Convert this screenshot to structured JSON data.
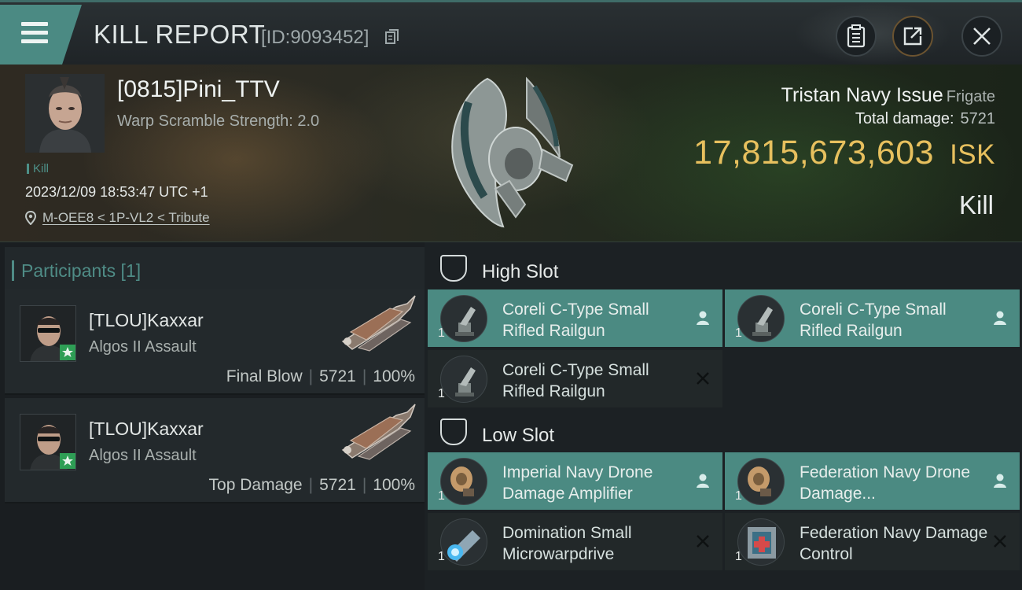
{
  "window": {
    "title": "KILL REPORT",
    "report_id": "[ID:9093452]"
  },
  "victim": {
    "name": "[0815]Pini_TTV",
    "warp_scramble": "Warp Scramble Strength: 2.0",
    "kill_tag": "Kill",
    "datetime": "2023/12/09 18:53:47 UTC +1",
    "location": "M-OEE8 < 1P-VL2 < Tribute",
    "ship_name": "Tristan Navy Issue",
    "ship_class": "Frigate",
    "total_damage_label": "Total damage:",
    "total_damage": "5721",
    "isk_value": "17,815,673,603",
    "isk_unit": "ISK",
    "kill_type": "Kill"
  },
  "participants": {
    "header": "Participants [1]",
    "items": [
      {
        "name": "[TLOU]Kaxxar",
        "ship": "Algos II Assault",
        "role": "Final Blow",
        "damage": "5721",
        "percent": "100%"
      },
      {
        "name": "[TLOU]Kaxxar",
        "ship": "Algos II Assault",
        "role": "Top Damage",
        "damage": "5721",
        "percent": "100%"
      }
    ]
  },
  "fitting": {
    "high_slot": {
      "title": "High Slot",
      "modules": [
        {
          "name": "Coreli C-Type Small Rifled Railgun",
          "qty": "1",
          "status": "dropped"
        },
        {
          "name": "Coreli C-Type Small Rifled Railgun",
          "qty": "1",
          "status": "dropped"
        },
        {
          "name": "Coreli C-Type Small Rifled Railgun",
          "qty": "1",
          "status": "destroyed"
        }
      ]
    },
    "low_slot": {
      "title": "Low Slot",
      "modules": [
        {
          "name": "Imperial Navy Drone Damage Amplifier",
          "qty": "1",
          "status": "dropped"
        },
        {
          "name": "Federation Navy Drone Damage...",
          "qty": "1",
          "status": "dropped"
        },
        {
          "name": "Domination Small Microwarpdrive",
          "qty": "1",
          "status": "destroyed"
        },
        {
          "name": "Federation Navy Damage Control",
          "qty": "1",
          "status": "destroyed"
        }
      ]
    }
  },
  "colors": {
    "accent_teal": "#4b8a83",
    "isk_gold": "#e7c05e"
  }
}
